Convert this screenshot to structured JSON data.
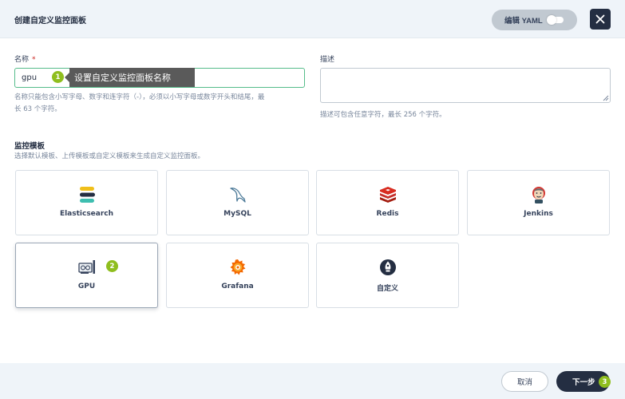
{
  "modal": {
    "title": "创建自定义监控面板",
    "yaml_label": "编辑 YAML",
    "close_glyph": "✕"
  },
  "form": {
    "name": {
      "label": "名称",
      "required_mark": "*",
      "value": "gpu",
      "hint_line1": "名称只能包含小写字母、数字和连字符（-），必须以小写字母或数字开头和结尾，最",
      "hint_line2": "长 63 个字符。"
    },
    "description": {
      "label": "描述",
      "value": "",
      "hint": "描述可包含任意字符，最长 256 个字符。"
    }
  },
  "tooltip": {
    "text": "设置自定义监控面板名称"
  },
  "badges": [
    "1",
    "2",
    "3"
  ],
  "templates": {
    "title": "监控模板",
    "hint": "选择默认模板、上传模板或自定义模板来生成自定义监控面板。",
    "items": [
      {
        "name": "Elasticsearch",
        "icon": "elasticsearch-icon",
        "selected": false
      },
      {
        "name": "MySQL",
        "icon": "mysql-icon",
        "selected": false
      },
      {
        "name": "Redis",
        "icon": "redis-icon",
        "selected": false
      },
      {
        "name": "Jenkins",
        "icon": "jenkins-icon",
        "selected": false
      },
      {
        "name": "GPU",
        "icon": "gpu-icon",
        "selected": true
      },
      {
        "name": "Grafana",
        "icon": "grafana-icon",
        "selected": false
      },
      {
        "name": "自定义",
        "icon": "custom-icon",
        "selected": false
      }
    ]
  },
  "footer": {
    "cancel_label": "取消",
    "next_label": "下一步"
  },
  "colors": {
    "accent_green": "#55bc8a",
    "badge_green": "#8fbe1e",
    "dark": "#242e42",
    "header_bg": "#eff4f9"
  }
}
